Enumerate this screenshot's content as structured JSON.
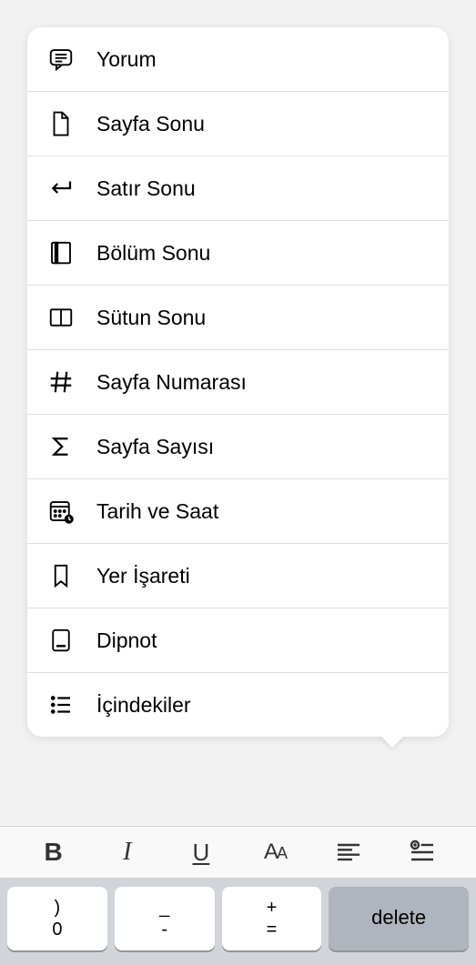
{
  "menu": {
    "items": [
      {
        "label": "Yorum",
        "icon": "comment"
      },
      {
        "label": "Sayfa Sonu",
        "icon": "page-break"
      },
      {
        "label": "Satır Sonu",
        "icon": "line-break"
      },
      {
        "label": "Bölüm Sonu",
        "icon": "section-break"
      },
      {
        "label": "Sütun Sonu",
        "icon": "column-break"
      },
      {
        "label": "Sayfa Numarası",
        "icon": "hash"
      },
      {
        "label": "Sayfa Sayısı",
        "icon": "sigma"
      },
      {
        "label": "Tarih ve Saat",
        "icon": "calendar"
      },
      {
        "label": "Yer İşareti",
        "icon": "bookmark"
      },
      {
        "label": "Dipnot",
        "icon": "footnote"
      },
      {
        "label": "İçindekiler",
        "icon": "list"
      }
    ]
  },
  "toolbar": {
    "bold": "B",
    "italic": "I",
    "underline": "U",
    "fontsize_large": "A",
    "fontsize_small": "A"
  },
  "keyboard": {
    "keys": [
      {
        "top": ")",
        "bottom": "0"
      },
      {
        "top": "_",
        "bottom": "-"
      },
      {
        "top": "+",
        "bottom": "="
      }
    ],
    "delete": "delete"
  }
}
